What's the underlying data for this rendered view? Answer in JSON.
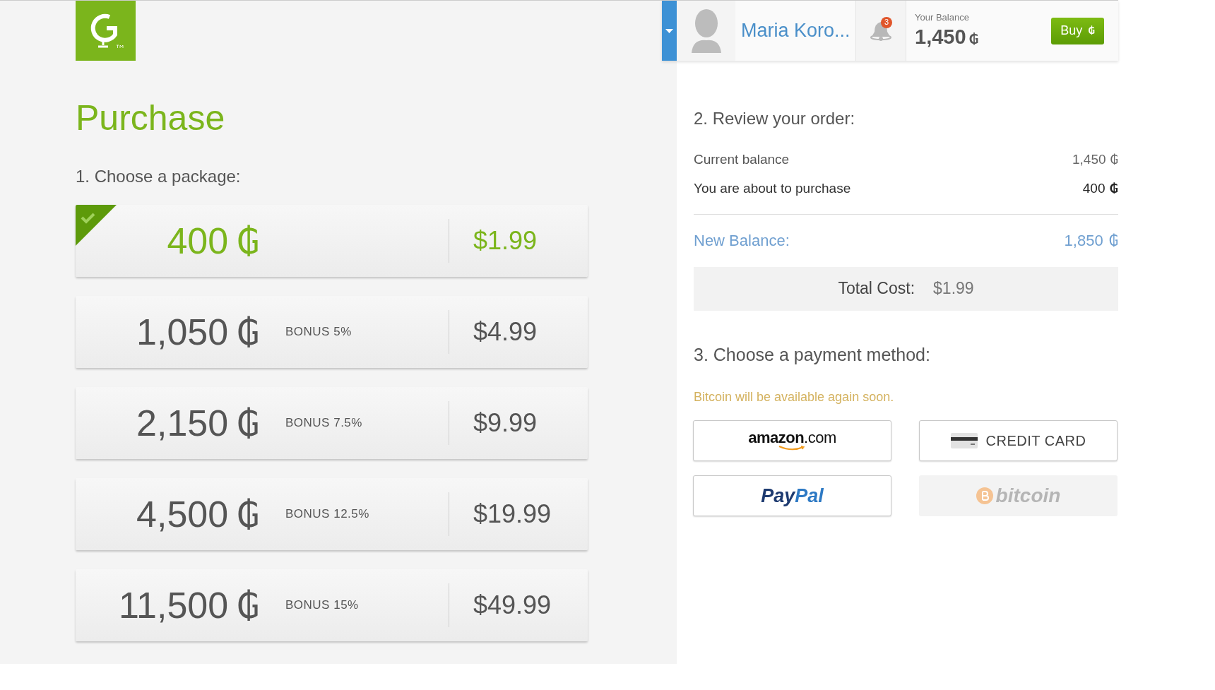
{
  "header": {
    "user_name": "Maria Koro...",
    "notifications": "3",
    "balance_label": "Your Balance",
    "balance": "1,450",
    "balance_currency": "₲",
    "buy_button": "Buy",
    "buy_currency": "₲"
  },
  "title": "Purchase",
  "packages_heading": "1. Choose a package:",
  "packages": [
    {
      "amount": "400",
      "currency": "₲",
      "price": "$1.99",
      "selected": true
    },
    {
      "amount": "1,050",
      "currency": "₲",
      "bonus": "BONUS 5%",
      "price": "$4.99",
      "selected": false
    },
    {
      "amount": "2,150",
      "currency": "₲",
      "bonus": "BONUS 7.5%",
      "price": "$9.99",
      "selected": false
    },
    {
      "amount": "4,500",
      "currency": "₲",
      "bonus": "BONUS 12.5%",
      "price": "$19.99",
      "selected": false
    },
    {
      "amount": "11,500",
      "currency": "₲",
      "bonus": "BONUS 15%",
      "price": "$49.99",
      "selected": false
    }
  ],
  "review": {
    "heading": "2. Review your order:",
    "rows": [
      {
        "label": "Current balance",
        "value": "1,450",
        "currency": "₲",
        "kind": "light"
      },
      {
        "label": "You are about to purchase",
        "value": "400",
        "currency": "₲",
        "kind": "strong"
      }
    ],
    "new_balance_label": "New Balance:",
    "new_balance": "1,850",
    "new_balance_currency": "₲",
    "total_label": "Total Cost:",
    "total_value": "$1.99"
  },
  "payment": {
    "heading": "3. Choose a payment method:",
    "notice": "Bitcoin will be available again soon.",
    "methods": [
      {
        "kind": "amazon",
        "label": "amazon",
        "suffix": ".com",
        "disabled": false
      },
      {
        "kind": "card",
        "label": "CREDIT CARD",
        "disabled": false
      },
      {
        "kind": "paypal",
        "label": "Pay",
        "suffix": "Pal",
        "disabled": false
      },
      {
        "kind": "bitcoin",
        "label": "bitcoin",
        "disabled": true
      }
    ]
  }
}
